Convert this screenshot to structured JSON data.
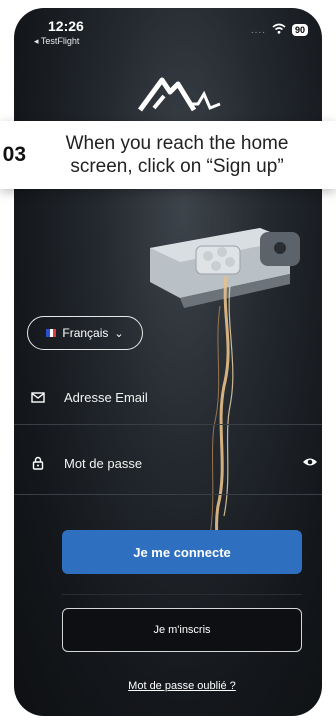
{
  "status_bar": {
    "time": "12:26",
    "back_app": "◂ TestFlight",
    "signal_dots": "....",
    "battery": "90"
  },
  "brand": {
    "logo_icon": "footbot-logo-icon"
  },
  "tutorial": {
    "step": "03",
    "text": "When you reach the home screen, click on “Sign up”"
  },
  "language": {
    "flag_icon": "french-flag-icon",
    "label": "Français",
    "chevron": "⌄"
  },
  "form": {
    "email_placeholder": "Adresse Email",
    "password_placeholder": "Mot de passe"
  },
  "actions": {
    "login_label": "Je me connecte",
    "signup_label": "Je m'inscris",
    "forgot_label": "Mot de passe oublié ?"
  },
  "colors": {
    "primary_button": "#2f6fc0",
    "background": "#14171b",
    "text": "#ffffff"
  }
}
